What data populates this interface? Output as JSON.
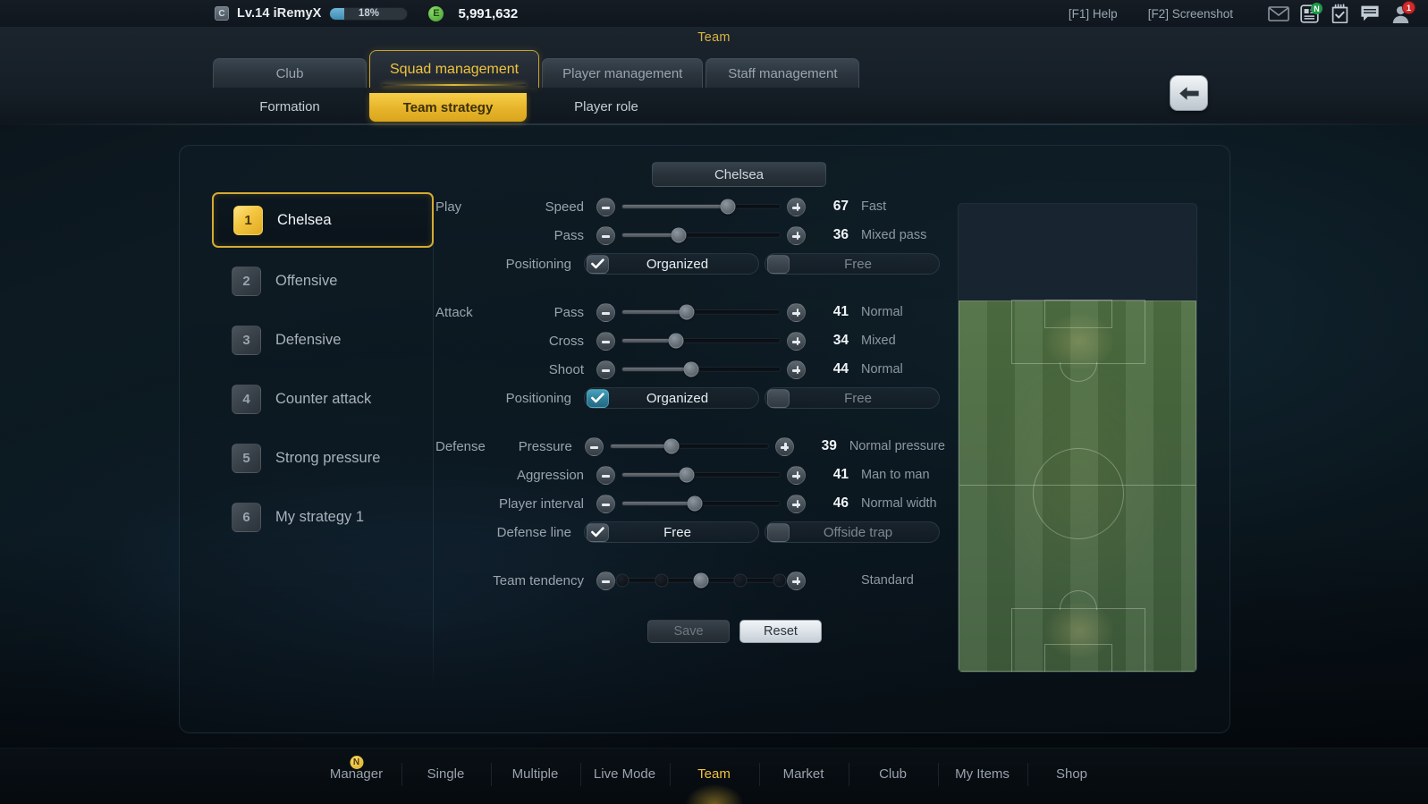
{
  "topbar": {
    "profile_icon": "c-coin-icon",
    "level_name": "Lv.14 iRemyX",
    "xp_percent": "18%",
    "xp_value": 18,
    "currency_icon": "e-coin-icon",
    "money": "5,991,632",
    "help_key": "[F1] Help",
    "screenshot_key": "[F2] Screenshot",
    "icons": [
      {
        "name": "mail-icon",
        "badge": ""
      },
      {
        "name": "news-icon",
        "badge": "N"
      },
      {
        "name": "tasks-icon",
        "badge": ""
      },
      {
        "name": "chat-icon",
        "badge": ""
      },
      {
        "name": "friends-icon",
        "badge": "1"
      }
    ]
  },
  "header": {
    "page_title": "Team",
    "back_button": "back-arrow",
    "tabs": [
      {
        "label": "Club",
        "active": false
      },
      {
        "label": "Squad management",
        "active": true
      },
      {
        "label": "Player management",
        "active": false
      },
      {
        "label": "Staff management",
        "active": false
      }
    ],
    "subtabs": [
      {
        "label": "Formation",
        "active": false
      },
      {
        "label": "Team strategy",
        "active": true
      },
      {
        "label": "Player role",
        "active": false
      }
    ]
  },
  "panel": {
    "team_name": "Chelsea",
    "strategies": [
      {
        "num": "1",
        "label": "Chelsea",
        "selected": true
      },
      {
        "num": "2",
        "label": "Offensive",
        "selected": false
      },
      {
        "num": "3",
        "label": "Defensive",
        "selected": false
      },
      {
        "num": "4",
        "label": "Counter attack",
        "selected": false
      },
      {
        "num": "5",
        "label": "Strong pressure",
        "selected": false
      },
      {
        "num": "6",
        "label": "My strategy 1",
        "selected": false
      }
    ],
    "groups": [
      {
        "title": "Play",
        "sliders": [
          {
            "label": "Speed",
            "value": "67",
            "pct": 67,
            "desc": "Fast"
          },
          {
            "label": "Pass",
            "value": "36",
            "pct": 36,
            "desc": "Mixed pass"
          }
        ],
        "toggle": {
          "label": "Positioning",
          "on_label": "Organized",
          "off_label": "Free",
          "selected": "on",
          "highlight": false
        }
      },
      {
        "title": "Attack",
        "sliders": [
          {
            "label": "Pass",
            "value": "41",
            "pct": 41,
            "desc": "Normal"
          },
          {
            "label": "Cross",
            "value": "34",
            "pct": 34,
            "desc": "Mixed"
          },
          {
            "label": "Shoot",
            "value": "44",
            "pct": 44,
            "desc": "Normal"
          }
        ],
        "toggle": {
          "label": "Positioning",
          "on_label": "Organized",
          "off_label": "Free",
          "selected": "on",
          "highlight": true
        }
      },
      {
        "title": "Defense",
        "sliders": [
          {
            "label": "Pressure",
            "value": "39",
            "pct": 39,
            "desc": "Normal pressure"
          },
          {
            "label": "Aggression",
            "value": "41",
            "pct": 41,
            "desc": "Man to man"
          },
          {
            "label": "Player interval",
            "value": "46",
            "pct": 46,
            "desc": "Normal width"
          }
        ],
        "toggle": {
          "label": "Defense line",
          "on_label": "Free",
          "off_label": "Offside trap",
          "selected": "on",
          "highlight": false
        }
      }
    ],
    "tendency": {
      "label": "Team tendency",
      "steps": 5,
      "current": 3,
      "desc": "Standard"
    },
    "buttons": {
      "save": "Save",
      "save_enabled": false,
      "reset": "Reset",
      "reset_enabled": true
    }
  },
  "bottomnav": {
    "items": [
      {
        "label": "Manager",
        "active": false,
        "badge": "N"
      },
      {
        "label": "Single",
        "active": false,
        "badge": ""
      },
      {
        "label": "Multiple",
        "active": false,
        "badge": ""
      },
      {
        "label": "Live Mode",
        "active": false,
        "badge": ""
      },
      {
        "label": "Team",
        "active": true,
        "badge": ""
      },
      {
        "label": "Market",
        "active": false,
        "badge": ""
      },
      {
        "label": "Club",
        "active": false,
        "badge": ""
      },
      {
        "label": "My Items",
        "active": false,
        "badge": ""
      },
      {
        "label": "Shop",
        "active": false,
        "badge": ""
      }
    ]
  },
  "colors": {
    "accent_gold": "#f0c33c",
    "teal_highlight": "#2e7e99",
    "panel_bg": "#101d26",
    "pitch_green": "#49693e"
  }
}
